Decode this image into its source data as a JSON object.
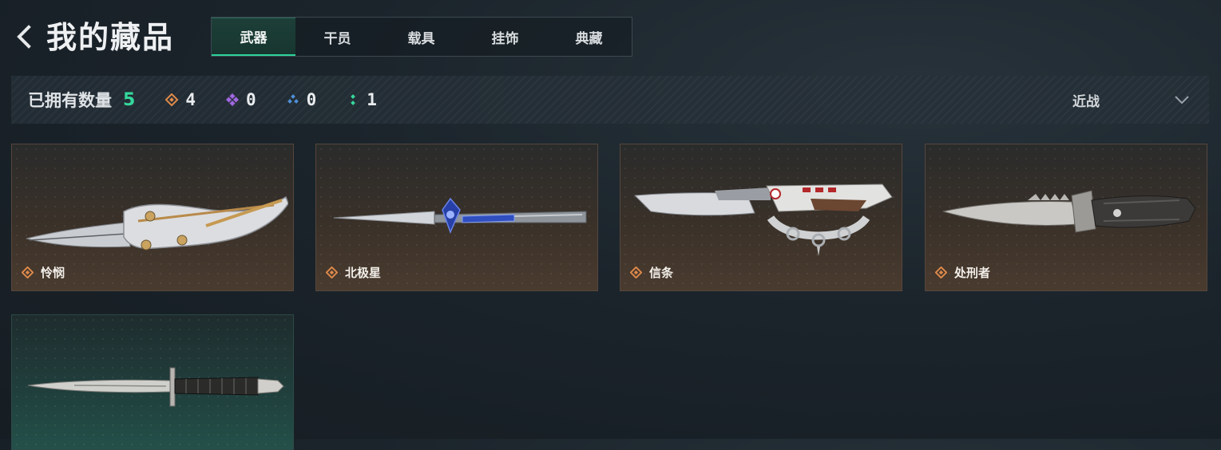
{
  "header": {
    "title": "我的藏品",
    "tabs": [
      {
        "label": "武器",
        "active": true
      },
      {
        "label": "干员",
        "active": false
      },
      {
        "label": "载具",
        "active": false
      },
      {
        "label": "挂饰",
        "active": false
      },
      {
        "label": "典藏",
        "active": false
      }
    ]
  },
  "stats": {
    "label": "已拥有数量",
    "total": "5",
    "rarity_counts": [
      {
        "icon": "orange-diamond-icon",
        "color": "#e08a4a",
        "count": "4"
      },
      {
        "icon": "purple-diamond-icon",
        "color": "#a067e0",
        "count": "0"
      },
      {
        "icon": "blue-diamond-icon",
        "color": "#4f8fd8",
        "count": "0"
      },
      {
        "icon": "green-diamond-icon",
        "color": "#35d89c",
        "count": "1"
      }
    ],
    "filter_label": "近战"
  },
  "items": [
    {
      "name": "怜悯",
      "rarity": "orange",
      "icon": "folding-knife-icon"
    },
    {
      "name": "北极星",
      "rarity": "orange",
      "icon": "stiletto-knife-icon"
    },
    {
      "name": "信条",
      "rarity": "orange",
      "icon": "knuckle-knife-icon"
    },
    {
      "name": "处刑者",
      "rarity": "orange",
      "icon": "tactical-knife-icon"
    },
    {
      "name": "",
      "rarity": "green",
      "icon": "dagger-icon"
    }
  ],
  "colors": {
    "accent_green": "#35d89c",
    "rarity_orange": "#e08a4a"
  }
}
